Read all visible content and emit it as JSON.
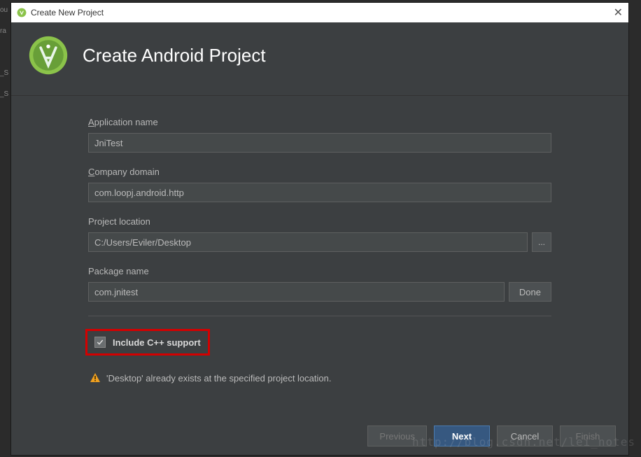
{
  "titlebar": {
    "title": "Create New Project"
  },
  "header": {
    "title": "Create Android Project"
  },
  "form": {
    "application_name": {
      "label": "Application name",
      "mnemonic": "A",
      "rest": "pplication name",
      "value": "JniTest"
    },
    "company_domain": {
      "label": "Company domain",
      "mnemonic": "C",
      "rest": "ompany domain",
      "value": "com.loopj.android.http"
    },
    "project_location": {
      "label": "Project location",
      "value": "C:/Users/Eviler/Desktop",
      "browse": "..."
    },
    "package_name": {
      "label": "Package name",
      "value": "com.jnitest",
      "done": "Done"
    },
    "cpp_support": {
      "label": "Include C++ support",
      "checked": true
    }
  },
  "warning": {
    "text": "'Desktop' already exists at the specified project location."
  },
  "buttons": {
    "previous": "Previous",
    "next": "Next",
    "cancel": "Cancel",
    "finish": "Finish"
  },
  "watermark": "http://blog.csdn.net/lei_notes"
}
